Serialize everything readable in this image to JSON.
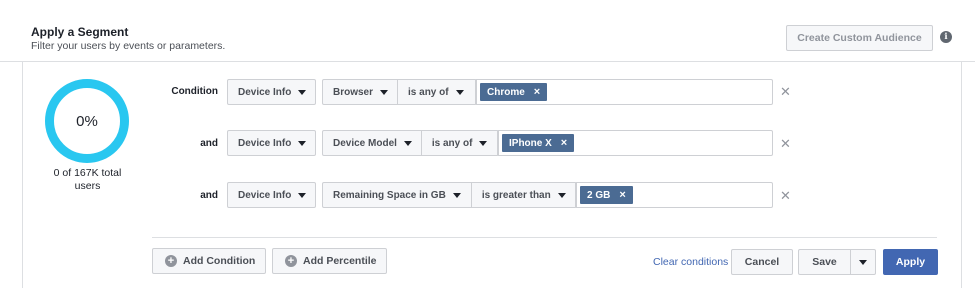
{
  "header": {
    "title": "Apply a Segment",
    "subtitle": "Filter your users by events or parameters.",
    "custom_audience_label": "Create Custom Audience",
    "info_icon": "i"
  },
  "summary": {
    "percent": "0%",
    "percent_value": 0,
    "users_text": "0 of 167K total users"
  },
  "conditions": [
    {
      "label": "Condition",
      "category": "Device Info",
      "field": "Browser",
      "operator": "is any of",
      "values": [
        "Chrome"
      ]
    },
    {
      "label": "and",
      "category": "Device Info",
      "field": "Device Model",
      "operator": "is any of",
      "values": [
        "IPhone X"
      ]
    },
    {
      "label": "and",
      "category": "Device Info",
      "field": "Remaining Space in GB",
      "operator": "is greater than",
      "values": [
        "2 GB"
      ]
    }
  ],
  "footer": {
    "add_condition": "Add Condition",
    "add_percentile": "Add Percentile",
    "clear_conditions": "Clear conditions",
    "cancel": "Cancel",
    "save": "Save",
    "apply": "Apply"
  },
  "colors": {
    "accent": "#4267b2",
    "donut": "#29c7f0",
    "token": "#4b6b93"
  }
}
